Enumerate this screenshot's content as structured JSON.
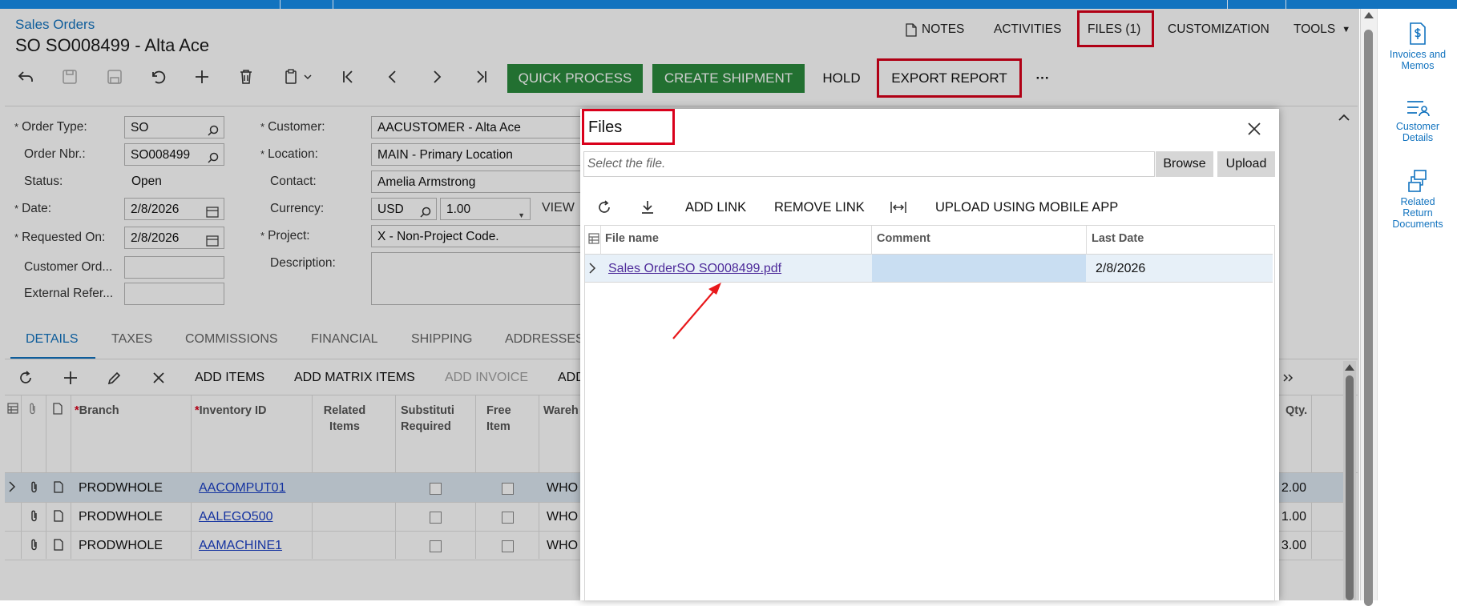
{
  "header": {
    "breadcrumb": "Sales Orders",
    "title": "SO SO008499 - Alta Ace",
    "menu": {
      "notes": "NOTES",
      "activities": "ACTIVITIES",
      "files": "FILES (1)",
      "customization": "CUSTOMIZATION",
      "tools": "TOOLS"
    }
  },
  "toolbar": {
    "quick_process": "QUICK PROCESS",
    "create_shipment": "CREATE SHIPMENT",
    "hold": "HOLD",
    "export_report": "EXPORT REPORT",
    "more": "···",
    "icons": [
      "undo-arrow-icon",
      "save-disabled-icon",
      "save-close-disabled-icon",
      "revert-icon",
      "add-icon",
      "delete-icon",
      "copy-paste-icon",
      "first-record-icon",
      "previous-record-icon",
      "next-record-icon",
      "last-record-icon"
    ]
  },
  "form": {
    "order_type_label": "Order Type:",
    "order_type": "SO",
    "order_nbr_label": "Order Nbr.:",
    "order_nbr": "SO008499",
    "status_label": "Status:",
    "status": "Open",
    "date_label": "Date:",
    "date": "2/8/2026",
    "requested_on_label": "Requested On:",
    "requested_on": "2/8/2026",
    "customer_ord_label": "Customer Ord...",
    "customer_ord": "",
    "external_ref_label": "External Refer...",
    "external_ref": "",
    "customer_label": "Customer:",
    "customer": "AACUSTOMER - Alta Ace",
    "location_label": "Location:",
    "location": "MAIN - Primary Location",
    "contact_label": "Contact:",
    "contact": "Amelia Armstrong",
    "currency_label": "Currency:",
    "currency": "USD",
    "rate": "1.00",
    "view_label": "VIEW",
    "project_label": "Project:",
    "project": "X - Non-Project Code.",
    "description_label": "Description:",
    "description": ""
  },
  "tabs": [
    "DETAILS",
    "TAXES",
    "COMMISSIONS",
    "FINANCIAL",
    "SHIPPING",
    "ADDRESSES"
  ],
  "grid": {
    "toolbar": {
      "add_items": "ADD ITEMS",
      "add_matrix_items": "ADD MATRIX ITEMS",
      "add_invoice": "ADD INVOICE",
      "add_more": "ADD"
    },
    "columns": {
      "branch": "Branch",
      "inventory_id": "Inventory ID",
      "related_1": "Related",
      "related_2": "Items",
      "subst_1": "Substituti",
      "subst_2": "Required",
      "free_1": "Free",
      "free_2": "Item",
      "warehouse": "Wareh",
      "qty": "Qty."
    },
    "rows": [
      {
        "branch": "PRODWHOLE",
        "inventory_id": "AACOMPUT01",
        "warehouse": "WHO",
        "qty": "2.00"
      },
      {
        "branch": "PRODWHOLE",
        "inventory_id": "AALEGO500",
        "warehouse": "WHO",
        "qty": "1.00"
      },
      {
        "branch": "PRODWHOLE",
        "inventory_id": "AAMACHINE1",
        "warehouse": "WHO",
        "qty": "3.00"
      }
    ]
  },
  "files_dialog": {
    "title": "Files",
    "file_placeholder": "Select the file.",
    "browse": "Browse",
    "upload": "Upload",
    "add_link": "ADD LINK",
    "remove_link": "REMOVE LINK",
    "upload_mobile": "UPLOAD USING MOBILE APP",
    "columns": {
      "file_name": "File name",
      "comment": "Comment",
      "last_date": "Last Date"
    },
    "files": [
      {
        "file_name": "Sales OrderSO SO008499.pdf",
        "comment": "",
        "last_date": "2/8/2026"
      }
    ]
  },
  "right_panel": [
    {
      "label_1": "Invoices and",
      "label_2": "Memos"
    },
    {
      "label_1": "Customer",
      "label_2": "Details"
    },
    {
      "label_1": "Related",
      "label_2": "Return",
      "label_3": "Documents"
    }
  ],
  "colors": {
    "accent": "#1273bf",
    "green_button": "#2a8b3d",
    "highlight_red": "#d9001b",
    "link": "#1a3fc6"
  }
}
